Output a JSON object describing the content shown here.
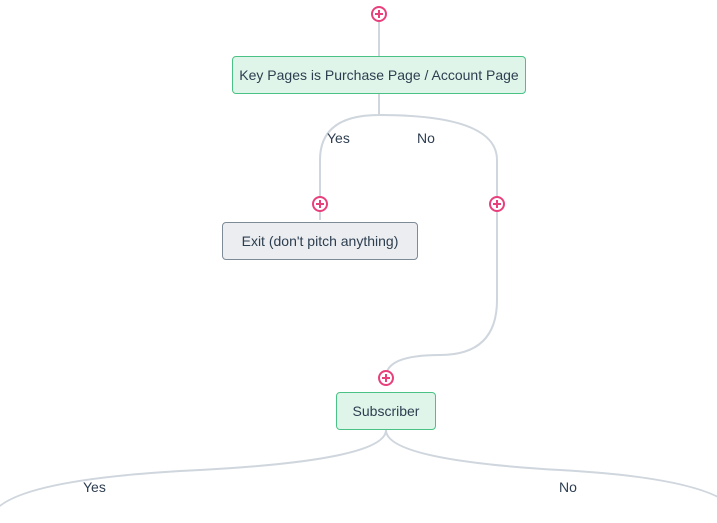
{
  "nodes": {
    "condition1": {
      "label": "Key Pages is Purchase Page / Account Page",
      "branches": {
        "yes": "Yes",
        "no": "No"
      }
    },
    "exit": {
      "label": "Exit (don't pitch anything)"
    },
    "condition2": {
      "label": "Subscriber",
      "branches": {
        "yes": "Yes",
        "no": "No"
      }
    }
  }
}
